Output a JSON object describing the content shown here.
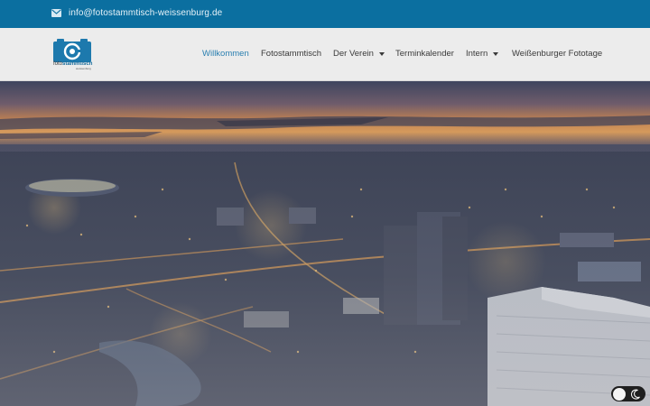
{
  "topbar": {
    "email": "info@fotostammtisch-weissenburg.de",
    "mail_icon": "envelope-icon"
  },
  "logo": {
    "word_foto": "foto",
    "word_stammtisch": "stammtisch",
    "sub": "weissenburg",
    "icon": "camera-icon"
  },
  "nav": {
    "items": [
      {
        "label": "Willkommen",
        "active": true,
        "dropdown": false
      },
      {
        "label": "Fotostammtisch",
        "active": false,
        "dropdown": false
      },
      {
        "label": "Der Verein",
        "active": false,
        "dropdown": true
      },
      {
        "label": "Terminkalender",
        "active": false,
        "dropdown": false
      },
      {
        "label": "Intern",
        "active": false,
        "dropdown": true
      },
      {
        "label": "Weißenburger Fototage",
        "active": false,
        "dropdown": false
      }
    ]
  },
  "theme_toggle": {
    "light_icon": "sun-knob-icon",
    "dark_icon": "moon-icon"
  },
  "colors": {
    "topbar": "#0b6fa0",
    "accent": "#2a7fb0",
    "header_bg": "#ececec"
  }
}
